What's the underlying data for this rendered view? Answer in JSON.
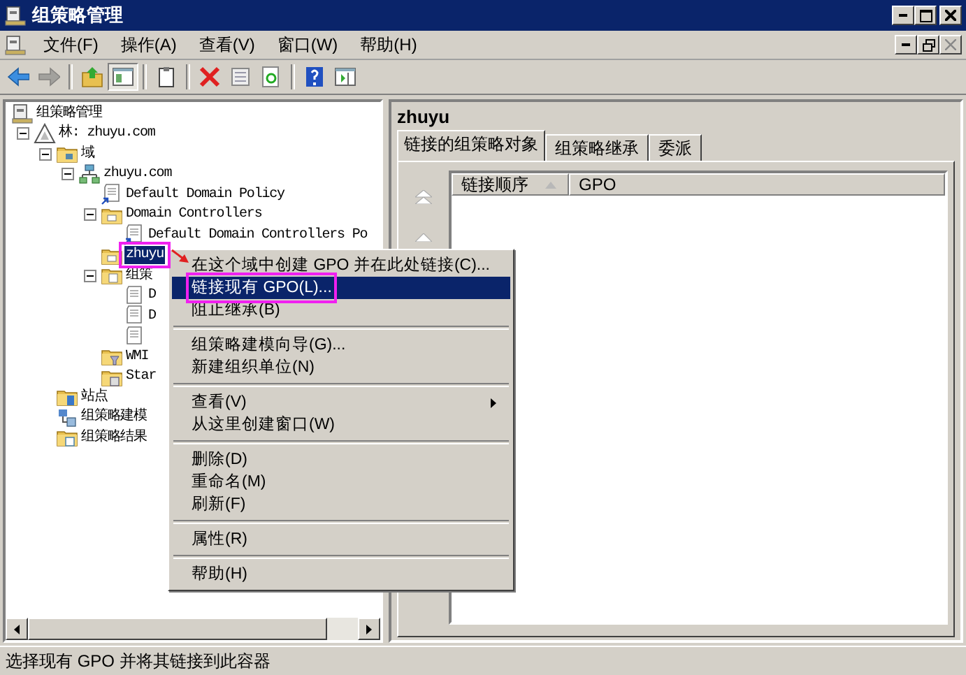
{
  "window": {
    "title": "组策略管理"
  },
  "menu_bar": [
    {
      "label": "文件(F)"
    },
    {
      "label": "操作(A)"
    },
    {
      "label": "查看(V)"
    },
    {
      "label": "窗口(W)"
    },
    {
      "label": "帮助(H)"
    }
  ],
  "toolbar": [
    {
      "kind": "back",
      "disabled": false,
      "pressed": false
    },
    {
      "kind": "forward",
      "disabled": true,
      "pressed": false
    },
    {
      "kind": "separator"
    },
    {
      "kind": "up",
      "disabled": false,
      "pressed": false
    },
    {
      "kind": "tree",
      "disabled": false,
      "pressed": true
    },
    {
      "kind": "separator"
    },
    {
      "kind": "clipboard",
      "disabled": false,
      "pressed": false
    },
    {
      "kind": "separator"
    },
    {
      "kind": "delete",
      "disabled": false,
      "pressed": false
    },
    {
      "kind": "properties",
      "disabled": false,
      "pressed": false
    },
    {
      "kind": "refresh",
      "disabled": false,
      "pressed": false
    },
    {
      "kind": "separator"
    },
    {
      "kind": "help",
      "disabled": false,
      "pressed": false
    },
    {
      "kind": "pane",
      "disabled": false,
      "pressed": false
    }
  ],
  "tree": [
    {
      "label": "组策略管理",
      "kind": "console",
      "selected": false,
      "children": [
        {
          "label": "林: zhuyu.com",
          "kind": "forest",
          "expanded": true,
          "selected": false,
          "children": [
            {
              "label": "域",
              "kind": "domains",
              "expanded": true,
              "selected": false,
              "children": [
                {
                  "label": "zhuyu.com",
                  "kind": "domain",
                  "expanded": true,
                  "selected": false,
                  "children": [
                    {
                      "label": "Default Domain Policy",
                      "kind": "gpo-link",
                      "selected": false
                    },
                    {
                      "label": "Domain Controllers",
                      "kind": "ou",
                      "expanded": true,
                      "selected": false,
                      "children": [
                        {
                          "label": "Default Domain Controllers Po",
                          "kind": "gpo-link",
                          "selected": false
                        }
                      ]
                    },
                    {
                      "label": "zhuyu",
                      "kind": "ou",
                      "selected": true
                    },
                    {
                      "label": "组策",
                      "kind": "gpo-folder",
                      "expanded": true,
                      "selected": false,
                      "children": [
                        {
                          "label": "D",
                          "kind": "gpo",
                          "selected": false
                        },
                        {
                          "label": "D",
                          "kind": "gpo",
                          "selected": false
                        },
                        {
                          "kind": "gpo",
                          "selected": false
                        }
                      ]
                    },
                    {
                      "label": "WMI",
                      "kind": "wmi-folder",
                      "selected": false
                    },
                    {
                      "label": "Star",
                      "kind": "starter-folder",
                      "selected": false
                    }
                  ]
                }
              ]
            },
            {
              "label": "站点",
              "kind": "sites",
              "selected": false
            },
            {
              "label": "组策略建模",
              "kind": "modeling",
              "selected": false
            },
            {
              "label": "组策略结果",
              "kind": "results",
              "selected": false
            }
          ]
        }
      ]
    }
  ],
  "details": {
    "title": "zhuyu",
    "tabs": [
      {
        "label": "链接的组策略对象",
        "selected": true
      },
      {
        "label": "组策略继承",
        "selected": false
      },
      {
        "label": "委派",
        "selected": false
      }
    ],
    "columns": [
      {
        "label": "链接顺序",
        "sorted": true
      },
      {
        "label": "GPO",
        "sorted": false
      }
    ]
  },
  "context_menu": [
    {
      "kind": "item",
      "label": "在这个域中创建 GPO 并在此处链接(C)...",
      "selected": false,
      "submenu": false
    },
    {
      "kind": "item",
      "label": "链接现有 GPO(L)...",
      "selected": true,
      "submenu": false
    },
    {
      "kind": "item",
      "label": "阻止继承(B)",
      "selected": false,
      "submenu": false
    },
    {
      "kind": "separator"
    },
    {
      "kind": "item",
      "label": "组策略建模向导(G)...",
      "selected": false,
      "submenu": false
    },
    {
      "kind": "item",
      "label": "新建组织单位(N)",
      "selected": false,
      "submenu": false
    },
    {
      "kind": "separator"
    },
    {
      "kind": "item",
      "label": "查看(V)",
      "selected": false,
      "submenu": true
    },
    {
      "kind": "item",
      "label": "从这里创建窗口(W)",
      "selected": false,
      "submenu": false
    },
    {
      "kind": "separator"
    },
    {
      "kind": "item",
      "label": "删除(D)",
      "selected": false,
      "submenu": false
    },
    {
      "kind": "item",
      "label": "重命名(M)",
      "selected": false,
      "submenu": false
    },
    {
      "kind": "item",
      "label": "刷新(F)",
      "selected": false,
      "submenu": false
    },
    {
      "kind": "separator"
    },
    {
      "kind": "item",
      "label": "属性(R)",
      "selected": false,
      "submenu": false
    },
    {
      "kind": "separator"
    },
    {
      "kind": "item",
      "label": "帮助(H)",
      "selected": false,
      "submenu": false
    }
  ],
  "status_bar": {
    "text": "选择现有 GPO 并将其链接到此容器"
  }
}
